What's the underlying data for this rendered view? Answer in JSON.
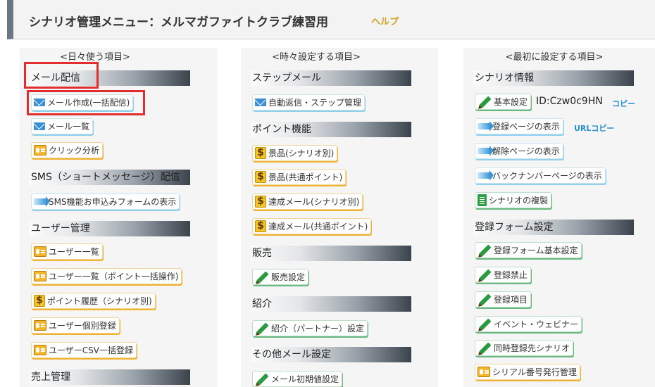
{
  "header": {
    "title": "シナリオ管理メニュー：メルマガファイトクラブ練習用",
    "help": "ヘルプ"
  },
  "col1": {
    "title": "<日々使う項目>",
    "sections": [
      "メール配信",
      "SMS（ショートメッセージ）配信",
      "ユーザー管理",
      "売上管理"
    ],
    "items": [
      "メール作成(一括配信)",
      "メール一覧",
      "クリック分析",
      "SMS機能お申込みフォームの表示",
      "ユーザー一覧",
      "ユーザー一覧（ポイント一括操作)",
      "ポイント履歴（シナリオ別)",
      "ユーザー個別登録",
      "ユーザーCSV一括登録"
    ]
  },
  "col2": {
    "title": "<時々設定する項目>",
    "sections": [
      "ステップメール",
      "ポイント機能",
      "販売",
      "紹介",
      "その他メール設定"
    ],
    "items": [
      "自動返信・ステップ管理",
      "景品(シナリオ別)",
      "景品(共通ポイント)",
      "達成メール(シナリオ別)",
      "達成メール(共通ポイント)",
      "販売設定",
      "紹介（パートナー）設定",
      "メール初期値設定"
    ]
  },
  "col3": {
    "title": "<最初に設定する項目>",
    "sections": [
      "シナリオ情報",
      "登録フォーム設定"
    ],
    "items": [
      "基本設定",
      "登録ページの表示",
      "解除ページの表示",
      "バックナンバーページの表示",
      "シナリオの複製",
      "登録フォーム基本設定",
      "登録禁止",
      "登録項目",
      "イベント・ウェビナー",
      "同時登録先シナリオ",
      "シリアル番号発行管理"
    ],
    "id_text": "ID:Czw0c9HN",
    "copy": "コピー",
    "url_copy": "URLコピー"
  },
  "colors": {
    "highlight": "#e02d2d",
    "help": "#d4a017",
    "link": "#2a8fd1"
  }
}
